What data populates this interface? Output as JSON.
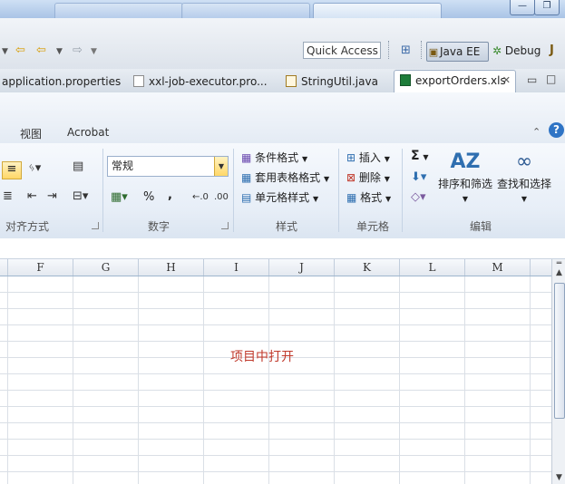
{
  "window": {
    "controls": {
      "minimize": "—",
      "maximize": "❐"
    }
  },
  "eclipse": {
    "quick_access_placeholder": "Quick Access",
    "perspectives": [
      "Java EE",
      "Debug"
    ]
  },
  "editor_tabs": [
    {
      "label": "application.properties",
      "active": false
    },
    {
      "label": "xxl-job-executor.pro...",
      "active": false
    },
    {
      "label": "StringUtil.java",
      "active": false
    },
    {
      "label": "exportOrders.xls",
      "active": true,
      "close_icon": "close-icon"
    }
  ],
  "ribbon": {
    "tabs": [
      "视图",
      "Acrobat"
    ],
    "number_format_value": "常规",
    "groups": [
      {
        "label": "对齐方式"
      },
      {
        "label": "数字"
      },
      {
        "label": "样式"
      },
      {
        "label": "单元格"
      },
      {
        "label": "编辑"
      }
    ],
    "styles": {
      "conditional_format": "条件格式",
      "table_format": "套用表格格式",
      "cell_style": "单元格样式"
    },
    "cells": {
      "insert": "插入",
      "delete": "删除",
      "format": "格式"
    },
    "editing": {
      "sort_filter": "排序和筛选",
      "find_select": "查找和选择",
      "sum_symbol": "Σ"
    },
    "number_symbols": {
      "percent": "%",
      "comma": ","
    }
  },
  "sheet": {
    "columns": [
      "F",
      "G",
      "H",
      "I",
      "J",
      "K",
      "L",
      "M"
    ],
    "overlay_message": "项目中打开"
  }
}
